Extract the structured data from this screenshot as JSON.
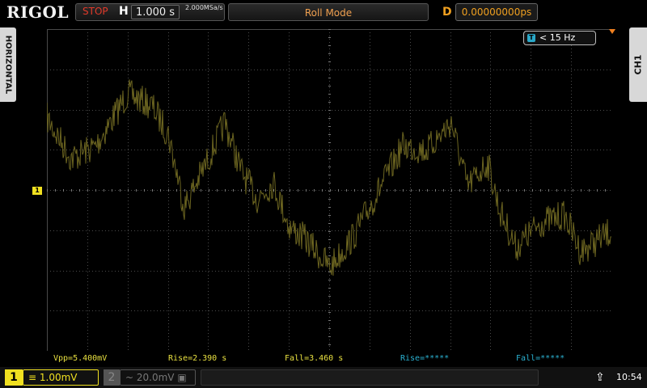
{
  "header": {
    "brand": "RIGOL",
    "run_state": "STOP",
    "horizontal_label": "H",
    "timebase": "1.000 s",
    "sample_rate": "2.000MSa/s",
    "mode": "Roll Mode",
    "delay_label": "D",
    "delay_value": "0.00000000ps"
  },
  "side": {
    "left_tab": "HORIZONTAL",
    "right_tab": "CH1"
  },
  "trigger": {
    "icon": "T",
    "text": "< 15 Hz"
  },
  "channel_marker": "1",
  "measurements": [
    {
      "text": "Vpp=5.400mV",
      "color": "#e8e040"
    },
    {
      "text": "Rise=2.390 s",
      "color": "#e8e040"
    },
    {
      "text": "Fall=3.460 s",
      "color": "#e8e040"
    },
    {
      "text": "Rise=*****",
      "color": "#2ab0d0"
    },
    {
      "text": "Fall=*****",
      "color": "#2ab0d0"
    }
  ],
  "footer": {
    "ch1_number": "1",
    "ch1_coupling_icon": "dc-coupling-icon",
    "ch1_scale": "1.00mV",
    "ch2_number": "2",
    "ch2_coupling_icon": "ac-coupling-icon",
    "ch2_scale": "20.0mV",
    "usb_icon": "usb-icon",
    "clock": "10:54"
  },
  "colors": {
    "ch1": "#f0e020",
    "ch2": "#2ab0d0",
    "trace": "#6b6420",
    "stop": "#e23a2a",
    "accent": "#f0a020"
  }
}
